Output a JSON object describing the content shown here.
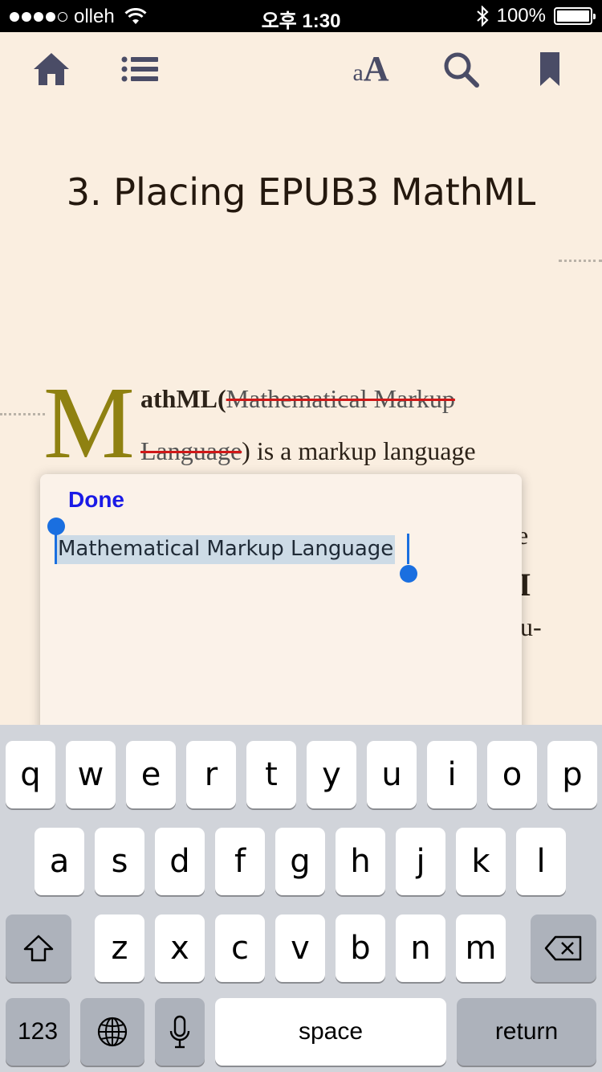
{
  "status_bar": {
    "carrier": "olleh",
    "time": "오후 1:30",
    "battery": "100%"
  },
  "toolbar": {
    "icons": [
      "home-icon",
      "list-icon",
      "font-size-icon",
      "search-icon",
      "bookmark-icon"
    ],
    "font_size_glyph": "aA"
  },
  "content": {
    "chapter_title": "3. Placing EPUB3 MathML",
    "dropcap": "M",
    "line1_start": "athML(",
    "line1_strike": "Mathematical Markup",
    "line2_strike": "Language",
    "line2_end": ") is a markup language",
    "fragment_1": "e",
    "fragment_2": "I",
    "fragment_3": "u-"
  },
  "memo_panel": {
    "done_label": "Done",
    "text": "Mathematical Markup Language"
  },
  "keyboard": {
    "row1": [
      "q",
      "w",
      "e",
      "r",
      "t",
      "y",
      "u",
      "i",
      "o",
      "p"
    ],
    "row2": [
      "a",
      "s",
      "d",
      "f",
      "g",
      "h",
      "j",
      "k",
      "l"
    ],
    "row3": [
      "z",
      "x",
      "c",
      "v",
      "b",
      "n",
      "m"
    ],
    "numbers_label": "123",
    "space_label": "space",
    "return_label": "return"
  }
}
